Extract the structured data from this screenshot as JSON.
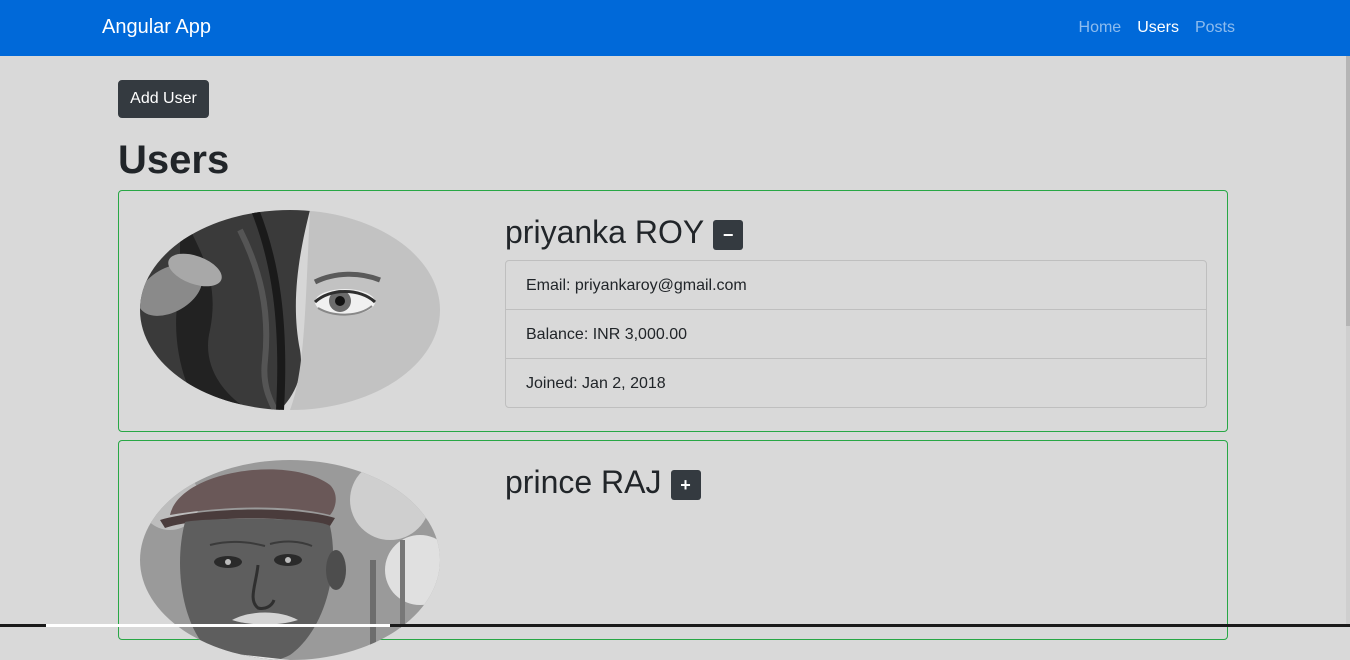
{
  "navbar": {
    "brand": "Angular App",
    "links": [
      {
        "label": "Home",
        "active": false
      },
      {
        "label": "Users",
        "active": true
      },
      {
        "label": "Posts",
        "active": false
      }
    ]
  },
  "add_user_label": "Add User",
  "page_title": "Users",
  "users": [
    {
      "name": "priyanka ROY",
      "toggle_symbol": "−",
      "expanded": true,
      "email": "Email: priyankaroy@gmail.com",
      "balance": "Balance: INR 3,000.00",
      "joined": "Joined: Jan 2, 2018"
    },
    {
      "name": "prince RAJ",
      "toggle_symbol": "+",
      "expanded": false
    }
  ],
  "colors": {
    "navbar_bg": "#0069d9",
    "page_bg": "#d9d9d9",
    "button_bg": "#343a40",
    "card_border": "#28a745"
  }
}
